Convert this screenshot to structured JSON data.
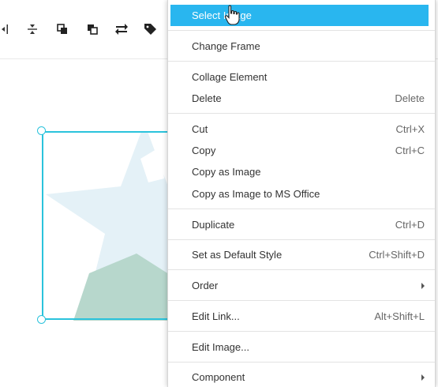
{
  "toolbar": {
    "icons": [
      "distribute-horizontal-icon",
      "align-center-vertical-icon",
      "bring-forward-icon",
      "send-backward-icon",
      "swap-icon",
      "tag-icon"
    ]
  },
  "menu": {
    "select_image": "Select Image",
    "change_frame": "Change Frame",
    "collage_element": "Collage Element",
    "delete": "Delete",
    "delete_sc": "Delete",
    "cut": "Cut",
    "cut_sc": "Ctrl+X",
    "copy": "Copy",
    "copy_sc": "Ctrl+C",
    "copy_as_image": "Copy as Image",
    "copy_as_image_ms": "Copy as Image to MS Office",
    "duplicate": "Duplicate",
    "duplicate_sc": "Ctrl+D",
    "set_default_style": "Set as Default Style",
    "set_default_style_sc": "Ctrl+Shift+D",
    "order": "Order",
    "edit_link": "Edit Link...",
    "edit_link_sc": "Alt+Shift+L",
    "edit_image": "Edit Image...",
    "component": "Component"
  },
  "colors": {
    "selection_border": "#2bc3dc",
    "menu_highlight": "#29b6ef",
    "star_fill": "#e4f1f7",
    "star_accent": "#b7d7cc"
  }
}
